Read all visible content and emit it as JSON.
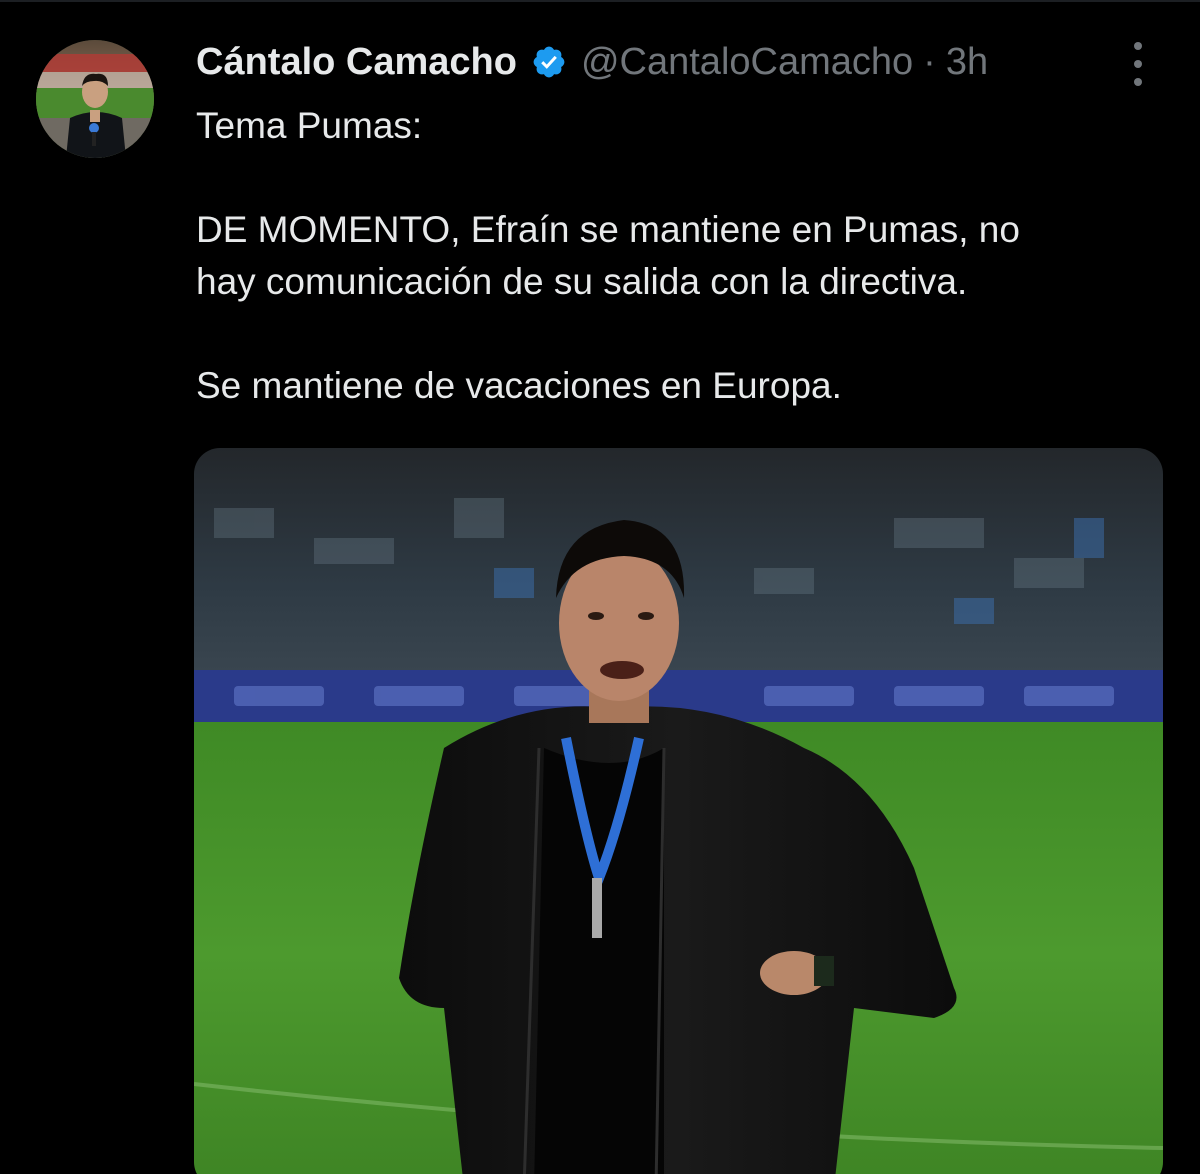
{
  "author": {
    "display_name": "Cántalo Camacho",
    "handle": "@CantaloCamacho",
    "separator": "·",
    "timestamp": "3h",
    "verified": true
  },
  "tweet": {
    "lines": [
      "Tema Pumas:",
      "",
      "DE MOMENTO, Efraín se mantiene en Pumas, no",
      "hay comunicación de su salida con la directiva.",
      "",
      "Se mantiene de vacaciones en Europa."
    ]
  },
  "icons": {
    "verified": "verified-badge-icon",
    "more": "more-options-icon"
  },
  "colors": {
    "background": "#000000",
    "text_primary": "#e7e9ea",
    "text_secondary": "#71767b",
    "verified_blue": "#1d9bf0",
    "pitch_green": "#4d9a2e"
  }
}
